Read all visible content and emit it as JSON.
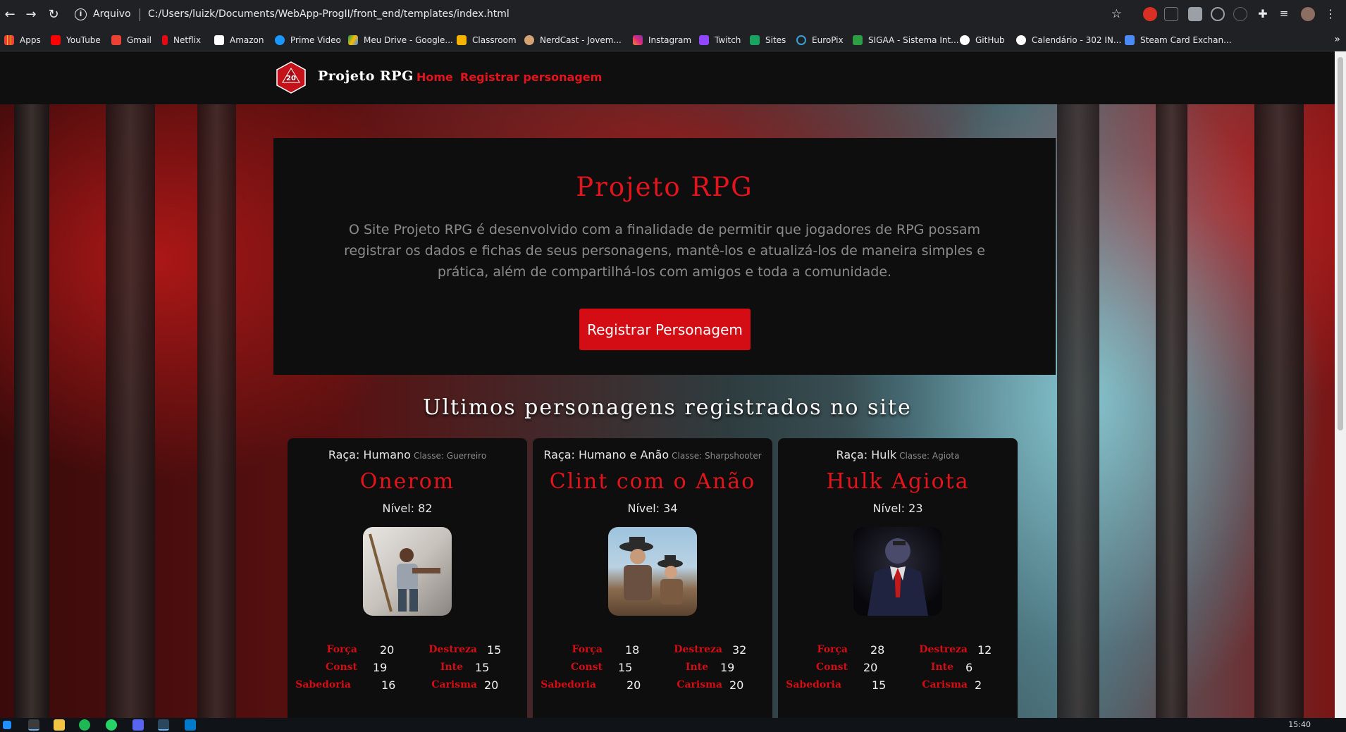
{
  "browser": {
    "scheme_label": "Arquivo",
    "url": "C:/Users/luizk/Documents/WebApp-ProgII/front_end/templates/index.html",
    "bookmarks": [
      {
        "label": "Apps",
        "icon": "apps-grid-icon",
        "color": "#ea4335"
      },
      {
        "label": "YouTube",
        "icon": "youtube-icon",
        "color": "#ff0000"
      },
      {
        "label": "Gmail",
        "icon": "gmail-icon",
        "color": "#ea4335"
      },
      {
        "label": "Netflix",
        "icon": "netflix-icon",
        "color": "#e50914"
      },
      {
        "label": "Amazon",
        "icon": "amazon-icon",
        "color": "#ffffff"
      },
      {
        "label": "Prime Video",
        "icon": "prime-video-icon",
        "color": "#1a98ff"
      },
      {
        "label": "Meu Drive - Google...",
        "icon": "google-drive-icon",
        "color": "#fbbc04"
      },
      {
        "label": "Classroom",
        "icon": "classroom-icon",
        "color": "#f4b400"
      },
      {
        "label": "NerdCast - Jovem...",
        "icon": "nerdcast-icon",
        "color": "#d4a373"
      },
      {
        "label": "Instagram",
        "icon": "instagram-icon",
        "color": "#e1306c"
      },
      {
        "label": "Twitch",
        "icon": "twitch-icon",
        "color": "#9146ff"
      },
      {
        "label": "Sites",
        "icon": "google-sites-icon",
        "color": "#1aa260"
      },
      {
        "label": "EuroPix",
        "icon": "europix-icon",
        "color": "#3aa0d8"
      },
      {
        "label": "SIGAA - Sistema Int...",
        "icon": "sigaa-icon",
        "color": "#2e9e44"
      },
      {
        "label": "GitHub",
        "icon": "github-icon",
        "color": "#ffffff"
      },
      {
        "label": "Calendário - 302 IN...",
        "icon": "calendar-icon",
        "color": "#ffffff"
      },
      {
        "label": "Steam Card Exchan...",
        "icon": "steam-card-icon",
        "color": "#4c8bf5"
      }
    ]
  },
  "site": {
    "brand": "Projeto RPG",
    "logo_number": "20",
    "nav": [
      "Home",
      "Registrar personagem"
    ],
    "hero": {
      "title": "Projeto RPG",
      "text": "O Site Projeto RPG é desenvolvido com a finalidade de permitir que jogadores de RPG possam registrar os dados e fichas de seus personagens, mantê-los e atualizá-los de maneira simples e prática, além de compartilhá-los com amigos e toda a comunidade.",
      "button": "Registrar Personagem"
    },
    "section_title": "Ultimos personagens registrados no site",
    "stat_labels": {
      "forca": "Força",
      "const": "Const",
      "sabedoria": "Sabedoria",
      "destreza": "Destreza",
      "inte": "Inte",
      "carisma": "Carisma"
    },
    "cards": [
      {
        "race": "Raça: Humano",
        "class": "Classe: Guerreiro",
        "name": "Onerom",
        "level": "Nível: 82",
        "forca": "20",
        "const": "19",
        "sabedoria": "16",
        "destreza": "15",
        "inte": "15",
        "carisma": "20"
      },
      {
        "race": "Raça: Humano e Anão",
        "class": "Classe: Sharpshooter",
        "name": "Clint com o Anão",
        "level": "Nível: 34",
        "forca": "18",
        "const": "15",
        "sabedoria": "20",
        "destreza": "32",
        "inte": "19",
        "carisma": "20"
      },
      {
        "race": "Raça: Hulk",
        "class": "Classe: Agiota",
        "name": "Hulk Agiota",
        "level": "Nível: 23",
        "forca": "28",
        "const": "20",
        "sabedoria": "15",
        "destreza": "12",
        "inte": "6",
        "carisma": "2"
      }
    ]
  },
  "taskbar": {
    "time": "15:40"
  },
  "colors": {
    "accent": "#e3141b",
    "button": "#d40d14",
    "panel": "#0e0e0e"
  }
}
